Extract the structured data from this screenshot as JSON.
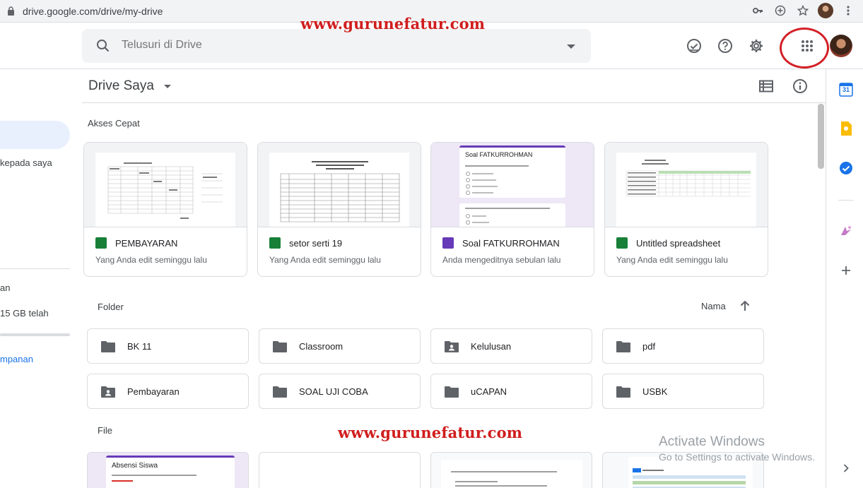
{
  "browser": {
    "url": "drive.google.com/drive/my-drive"
  },
  "watermark": {
    "top": "www.gurunefatur.com",
    "bottom": "www.gurunefatur.com"
  },
  "search": {
    "placeholder": "Telusuri di Drive"
  },
  "sidebar": {
    "shared_fragment": "kepada saya",
    "storage_fragment": "an",
    "storage_used_fragment": "15 GB telah",
    "buy_storage_fragment": "mpanan"
  },
  "main": {
    "title": "Drive Saya",
    "quick_access_label": "Akses Cepat",
    "folder_label": "Folder",
    "file_label": "File",
    "sort_label": "Nama"
  },
  "quick_access": [
    {
      "name": "PEMBAYARAN",
      "sub": "Yang Anda edit seminggu lalu",
      "type": "sheets"
    },
    {
      "name": "setor serti 19",
      "sub": "Yang Anda edit seminggu lalu",
      "type": "sheets"
    },
    {
      "name": "Soal FATKURROHMAN",
      "sub": "Anda mengeditnya sebulan lalu",
      "type": "forms",
      "preview_title": "Soal FATKURROHMAN"
    },
    {
      "name": "Untitled spreadsheet",
      "sub": "Yang Anda edit seminggu lalu",
      "type": "sheets"
    }
  ],
  "folders": [
    {
      "name": "BK 11",
      "shared": false
    },
    {
      "name": "Classroom",
      "shared": false
    },
    {
      "name": "Kelulusan",
      "shared": true
    },
    {
      "name": "pdf",
      "shared": false
    },
    {
      "name": "Pembayaran",
      "shared": true
    },
    {
      "name": "SOAL UJI COBA",
      "shared": false
    },
    {
      "name": "uCAPAN",
      "shared": false
    },
    {
      "name": "USBK",
      "shared": false
    }
  ],
  "files": [
    {
      "preview_title": "Absensi Siswa"
    }
  ],
  "windows": {
    "activate_title": "Activate Windows",
    "activate_sub": "Go to Settings to activate Windows."
  },
  "side_panel": {
    "calendar_day": "31"
  },
  "colors": {
    "sheets": "#188038",
    "forms": "#673ab7",
    "accent_blue": "#1a73e8",
    "watermark_red": "#d01d1d"
  }
}
